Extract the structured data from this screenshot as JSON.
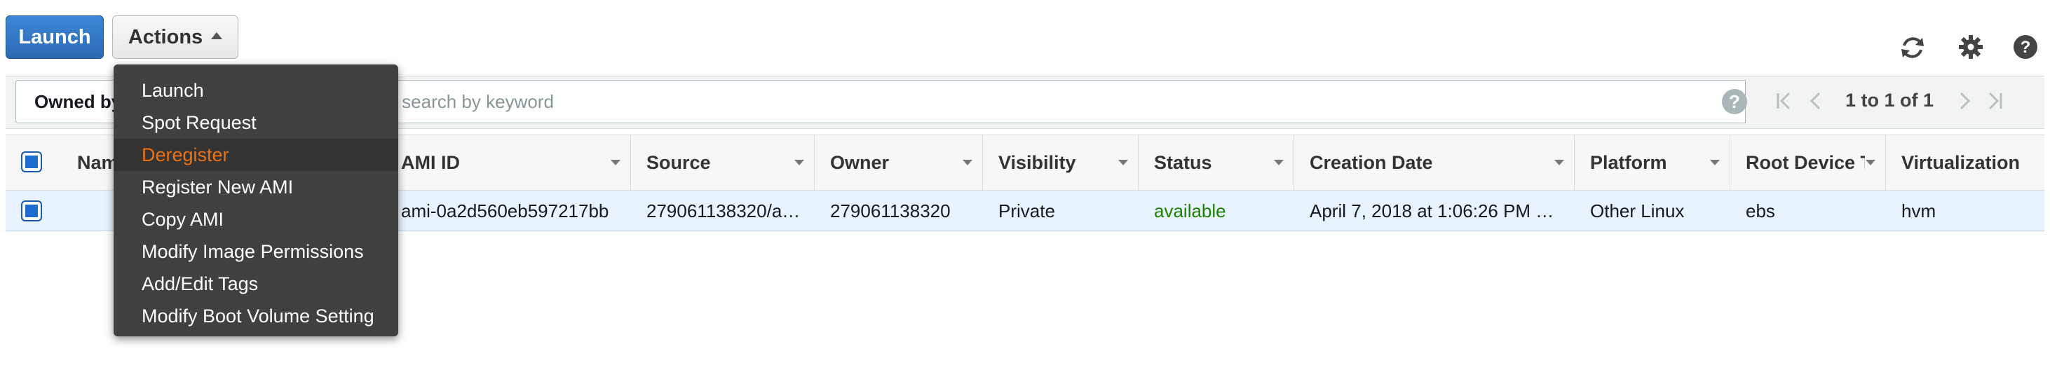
{
  "toolbar": {
    "launch_label": "Launch",
    "actions_label": "Actions"
  },
  "filter": {
    "owned_label": "Owned by me",
    "search_placeholder": "Filter by tags and attributes or search by keyword"
  },
  "pagination": {
    "text": "1 to 1 of 1"
  },
  "table": {
    "columns": [
      "Name",
      "AMI ID",
      "Source",
      "Owner",
      "Visibility",
      "Status",
      "Creation Date",
      "Platform",
      "Root Device Type",
      "Virtualization"
    ],
    "rows": [
      {
        "name": "",
        "ami_id": "ami-0a2d560eb597217bb",
        "source": "279061138320/a…",
        "owner": "279061138320",
        "visibility": "Private",
        "status": "available",
        "creation_date": "April 7, 2018 at 1:06:26 PM …",
        "platform": "Other Linux",
        "root_device": "ebs",
        "virtualization": "hvm"
      }
    ]
  },
  "actions_menu": {
    "items": [
      "Launch",
      "Spot Request",
      "Deregister",
      "Register New AMI",
      "Copy AMI",
      "Modify Image Permissions",
      "Add/Edit Tags",
      "Modify Boot Volume Setting"
    ],
    "highlighted_index": 2
  },
  "icons": {
    "refresh": "refresh-icon",
    "settings": "gear-icon",
    "help": "help-icon"
  },
  "colors": {
    "primary_button": "#2b6ab5",
    "status_available": "#1d8102",
    "menu_highlight": "#ec7211",
    "selected_row": "#e8f3fd"
  }
}
